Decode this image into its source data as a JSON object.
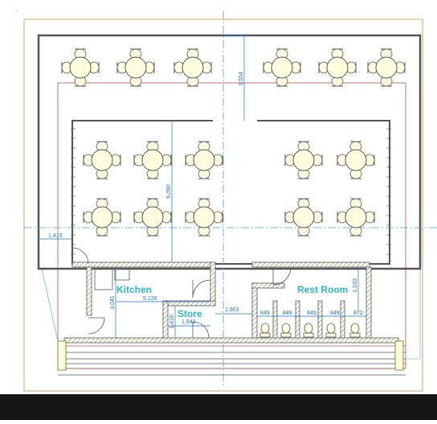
{
  "rooms": {
    "kitchen": "Kitchen",
    "store": "Store",
    "rest_room": "Rest Room"
  },
  "dimensions": {
    "top_vertical": "3,554",
    "hall_vertical": "6,090",
    "left_horizontal": "1,415",
    "kitchen_vertical": "3,041",
    "kitchen_horizontal": "5,126",
    "store_vertical": "1,416",
    "store_horizontal": "1,941",
    "corridor_horizontal": "1,603",
    "stall_1": "849",
    "stall_2": "849",
    "stall_3": "849",
    "stall_4": "849",
    "stall_5": "872",
    "restroom_vertical": "1,533"
  },
  "colors": {
    "wall": "#555555",
    "dimension": "#1a73c8",
    "axis": "#3aa8d8",
    "boundary": "#e0a050",
    "inner_line": "#c05050",
    "room_label": "#2fb5c8",
    "furniture_fill": "#fffce0",
    "hatch": "#8a8a40",
    "bottom_bar": "#161616"
  }
}
